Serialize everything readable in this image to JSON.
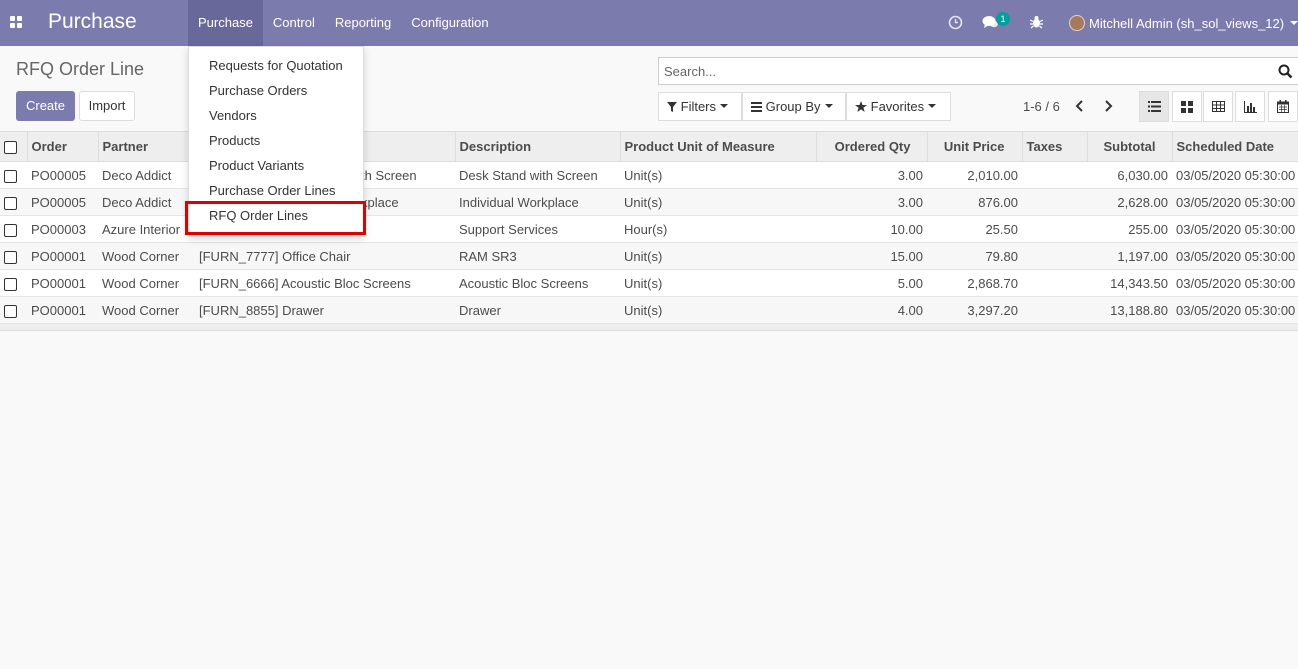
{
  "navbar": {
    "brand": "Purchase",
    "menu": [
      "Purchase",
      "Control",
      "Reporting",
      "Configuration"
    ],
    "message_count": "1",
    "user": "Mitchell Admin (sh_sol_views_12)"
  },
  "dropdown": {
    "items": [
      "Requests for Quotation",
      "Purchase Orders",
      "Vendors",
      "Products",
      "Product Variants",
      "Purchase Order Lines",
      "RFQ Order Lines"
    ],
    "highlighted": "RFQ Order Lines"
  },
  "control_panel": {
    "title": "RFQ Order Line",
    "create": "Create",
    "import": "Import",
    "search_placeholder": "Search...",
    "filters": "Filters",
    "group_by": "Group By",
    "favorites": "Favorites",
    "pager": "1-6 / 6"
  },
  "table": {
    "headers": [
      "Order",
      "Partner",
      "",
      "Description",
      "Product Unit of Measure",
      "Ordered Qty",
      "Unit Price",
      "Taxes",
      "Subtotal",
      "Scheduled Date"
    ],
    "rows": [
      [
        "PO00005",
        "Deco Addict",
        "th Screen",
        "Desk Stand with Screen",
        "Unit(s)",
        "3.00",
        "2,010.00",
        "",
        "6,030.00",
        "03/05/2020 05:30:00"
      ],
      [
        "PO00005",
        "Deco Addict",
        "kplace",
        "Individual Workplace",
        "Unit(s)",
        "3.00",
        "876.00",
        "",
        "2,628.00",
        "03/05/2020 05:30:00"
      ],
      [
        "PO00003",
        "Azure Interior",
        "",
        "Support Services",
        "Hour(s)",
        "10.00",
        "25.50",
        "",
        "255.00",
        "03/05/2020 05:30:00"
      ],
      [
        "PO00001",
        "Wood Corner",
        "[FURN_7777] Office Chair",
        "RAM SR3",
        "Unit(s)",
        "15.00",
        "79.80",
        "",
        "1,197.00",
        "03/05/2020 05:30:00"
      ],
      [
        "PO00001",
        "Wood Corner",
        "[FURN_6666] Acoustic Bloc Screens",
        "Acoustic Bloc Screens",
        "Unit(s)",
        "5.00",
        "2,868.70",
        "",
        "14,343.50",
        "03/05/2020 05:30:00"
      ],
      [
        "PO00001",
        "Wood Corner",
        "[FURN_8855] Drawer",
        "Drawer",
        "Unit(s)",
        "4.00",
        "3,297.20",
        "",
        "13,188.80",
        "03/05/2020 05:30:00"
      ]
    ]
  },
  "colors": {
    "navbar": "#7c7bad",
    "navbar_active": "#69689b",
    "badge": "#00a09d",
    "highlight": "#e00000"
  }
}
